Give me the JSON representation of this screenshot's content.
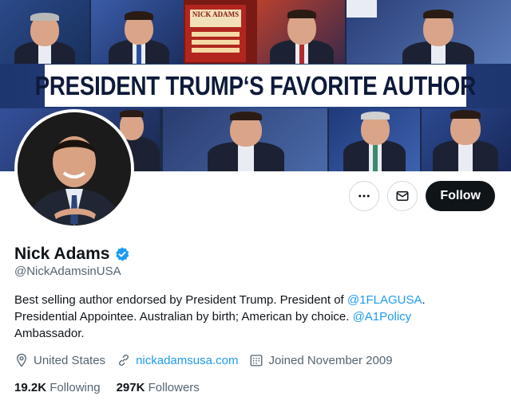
{
  "banner": {
    "title": "PRESIDENT TRUMP‘S FAVORITE AUTHOR",
    "book_title": "NICK ADAMS"
  },
  "profile": {
    "name": "Nick Adams",
    "handle": "@NickAdamsinUSA",
    "verified": true,
    "bio": {
      "line1_text": "Best selling author endorsed by President Trump. President of ",
      "line1_mention": "@1FLAGUSA",
      "line1_end": ".",
      "line2_text": "Presidential Appointee. Australian by birth; American by choice. ",
      "line2_mention": "@A1Policy",
      "line3_text": "Ambassador."
    },
    "location": "United States",
    "website": "nickadamsusa.com",
    "joined": "Joined November 2009",
    "following_count": "19.2K",
    "following_label": "Following",
    "followers_count": "297K",
    "followers_label": "Followers"
  },
  "actions": {
    "follow_label": "Follow",
    "more_icon": "more-icon",
    "message_icon": "mail-icon"
  },
  "colors": {
    "accent": "#1d9bf0",
    "follow_bg": "#0f1419",
    "verified": "#1d9bf0"
  }
}
